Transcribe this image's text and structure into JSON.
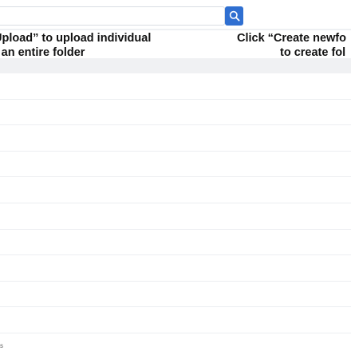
{
  "search": {
    "value": "",
    "placeholder": ""
  },
  "search_button": {
    "icon": "search-icon",
    "color": "#2f6fd1"
  },
  "instructions": {
    "left_line1": "Upload” to upload individual",
    "left_line2": "r an entire folder",
    "right_line1": "Click “Create newfo",
    "right_line2": "to create fol"
  },
  "table": {
    "rows": [
      "",
      "",
      "",
      "",
      "",
      "",
      "",
      "",
      "",
      "",
      ""
    ]
  },
  "footer": {
    "text": "s"
  }
}
